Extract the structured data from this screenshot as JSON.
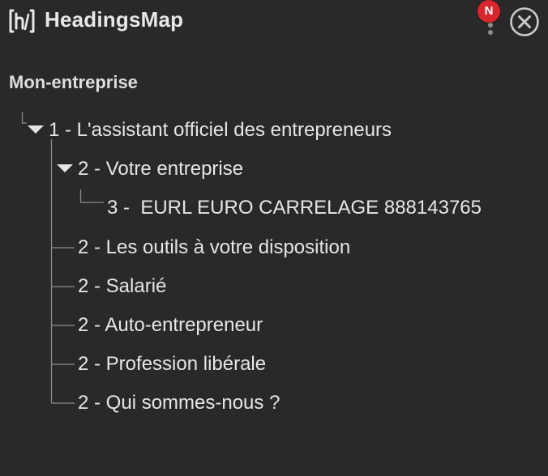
{
  "app": {
    "title": "HeadingsMap",
    "notification_badge": "N",
    "icons": {
      "logo": "headingsmap-logo-icon",
      "menu": "kebab-menu-icon",
      "close": "close-circle-icon"
    }
  },
  "page": {
    "title": "Mon-entreprise"
  },
  "tree": {
    "h1": "1 - L'assistant officiel des entrepreneurs",
    "h2_votre_entreprise": "2 - Votre entreprise",
    "h3_eurl": "3 -  EURL EURO CARRELAGE 888143765",
    "h2_outils": "2 - Les outils à votre disposition",
    "h2_salarie": "2 - Salarié",
    "h2_auto": "2 - Auto-entrepreneur",
    "h2_profession": "2 - Profession libérale",
    "h2_qui": "2 - Qui sommes-nous ?"
  },
  "colors": {
    "background": "#292929",
    "text": "#e6e6e6",
    "badge": "#d8262e",
    "tree_line": "#8a8a8a"
  }
}
